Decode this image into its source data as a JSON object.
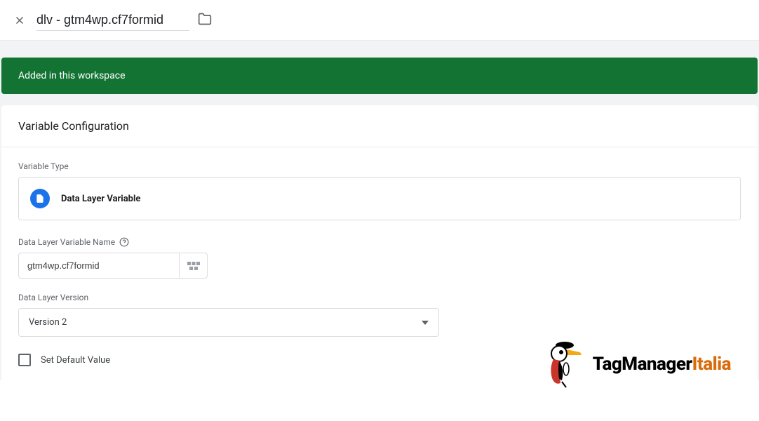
{
  "header": {
    "title": "dlv - gtm4wp.cf7formid"
  },
  "banner": {
    "text": "Added in this workspace"
  },
  "card": {
    "title": "Variable Configuration",
    "variable_type_label": "Variable Type",
    "variable_type_value": "Data Layer Variable",
    "variable_name_label": "Data Layer Variable Name",
    "variable_name_value": "gtm4wp.cf7formid",
    "version_label": "Data Layer Version",
    "version_value": "Version 2",
    "default_value_label": "Set Default Value"
  },
  "watermark": {
    "brand_part1": "TagManager",
    "brand_part2": "Italia"
  }
}
